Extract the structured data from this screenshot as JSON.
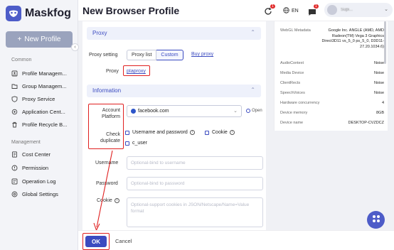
{
  "app": {
    "name": "Maskfog",
    "new_profile_label": "New Profile"
  },
  "sidebar": {
    "common_label": "Common",
    "common_items": [
      {
        "label": "Profile Managem..."
      },
      {
        "label": "Group Managem..."
      },
      {
        "label": "Proxy Service"
      },
      {
        "label": "Application Cent..."
      },
      {
        "label": "Profile Recycle B..."
      }
    ],
    "management_label": "Management",
    "management_items": [
      {
        "label": "Cost Center"
      },
      {
        "label": "Permission"
      },
      {
        "label": "Operation Log"
      },
      {
        "label": "Global Settings"
      }
    ]
  },
  "header": {
    "title": "New Browser Profile",
    "sync_badge": "1",
    "language": "EN",
    "message_badge": "1",
    "username": "Supi..."
  },
  "proxy_section": {
    "title": "Proxy",
    "setting_label": "Proxy setting",
    "options": [
      "Proxy list",
      "Custom"
    ],
    "buy_link": "Buy proxy",
    "proxy_label": "Proxy",
    "proxy_value": "pIaproxy"
  },
  "info_section": {
    "title": "Information",
    "account_platform_label": "Account Platform",
    "account_platform_value": "facebook.com",
    "open_label": "Open",
    "check_duplicate_label": "Check duplicate",
    "check_options": [
      "Username and password",
      "Cookie",
      "c_user"
    ],
    "username_label": "Username",
    "username_placeholder": "Optional-bind to username",
    "password_label": "Password",
    "password_placeholder": "Optional-bind to password",
    "cookie_label": "Cookie",
    "cookie_placeholder": "Optional-support cookies in JSON/Netscape/Name=Value format"
  },
  "footer": {
    "ok_label": "OK",
    "cancel_label": "Cancel"
  },
  "fingerprint_panel": {
    "rows": [
      {
        "key": "WebGL Metadata",
        "value": "Google Inc. ANGLE (AMD, AMD Radeon(TM) Vega 3 Graphics Direct3D11 vs_5_0 ps_5_0, D3D11-27.20.1034.6)"
      },
      {
        "key": "AudioContext",
        "value": "Noise"
      },
      {
        "key": "Media Device",
        "value": "Noise"
      },
      {
        "key": "ClientRects",
        "value": "Noise"
      },
      {
        "key": "SpeechVoices",
        "value": "Noise"
      },
      {
        "key": "Hardware concurrency",
        "value": "4"
      },
      {
        "key": "Device memory",
        "value": "8GB"
      },
      {
        "key": "Device name",
        "value": "DESKTOP-CVZDCZ"
      }
    ]
  },
  "colors": {
    "brand": "#3b4bc0",
    "annotation_red": "#e02020",
    "badge_red": "#e02c2c"
  }
}
